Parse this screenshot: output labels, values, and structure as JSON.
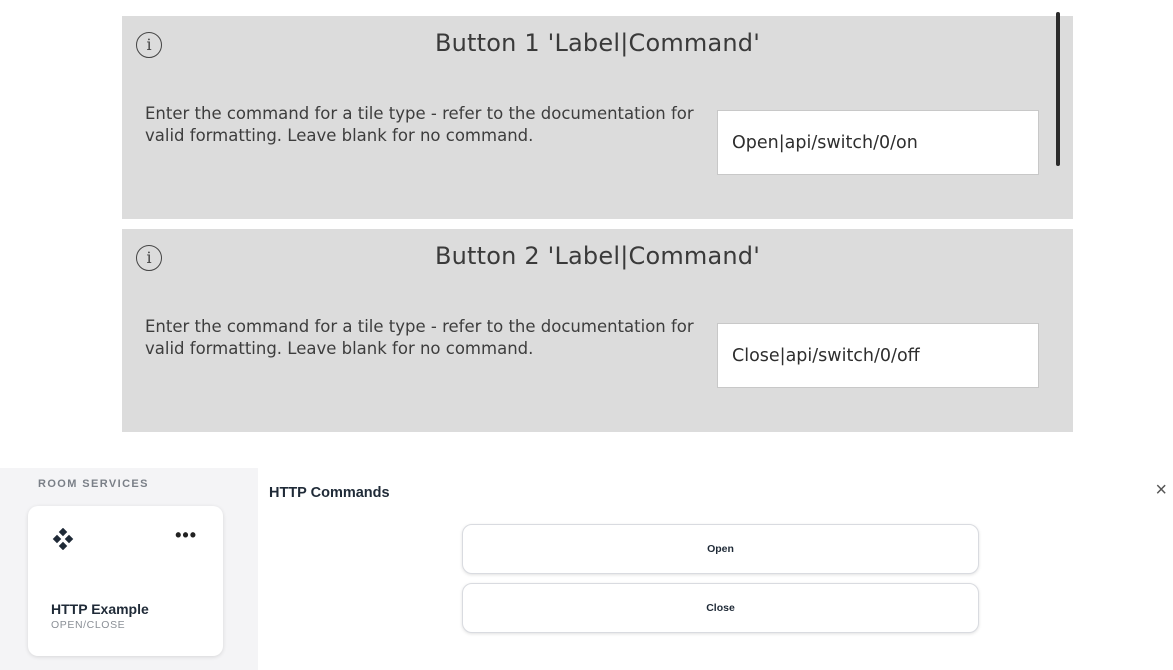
{
  "config_panels": [
    {
      "title": "Button 1 'Label|Command'",
      "description": "Enter the command for a tile type - refer to the documentation for valid formatting.  Leave blank for no command.",
      "value": "Open|api/switch/0/on"
    },
    {
      "title": "Button 2 'Label|Command'",
      "description": "Enter the command for a tile type - refer to the documentation for valid formatting.  Leave blank for no command.",
      "value": "Close|api/switch/0/off"
    }
  ],
  "info_icon_glyph": "i",
  "dashboard": {
    "section_label": "ROOM SERVICES",
    "tile": {
      "icon": "diamond-grid-icon",
      "menu_glyph": "•••",
      "name": "HTTP Example",
      "subtitle": "OPEN/CLOSE"
    }
  },
  "modal": {
    "title": "HTTP Commands",
    "close_glyph": "×",
    "buttons": [
      {
        "label": "Open"
      },
      {
        "label": "Close"
      }
    ]
  },
  "colors": {
    "panel_bg": "#dcdcdc",
    "dashboard_bg": "#f4f4f6",
    "text_dark": "#1f2a37"
  }
}
